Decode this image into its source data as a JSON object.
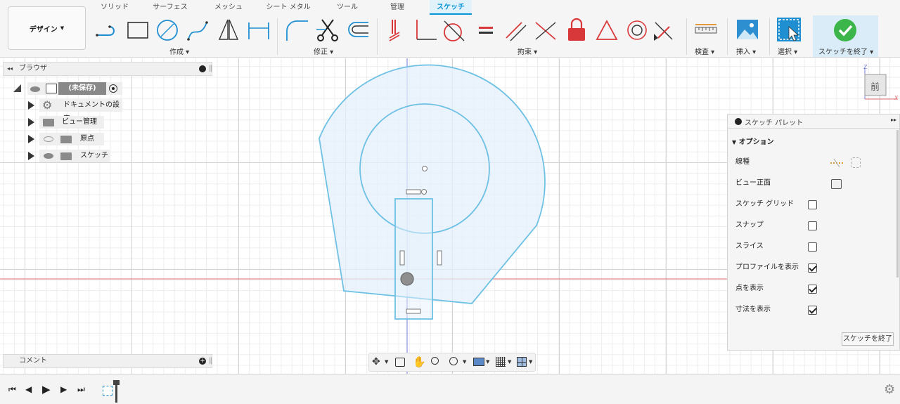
{
  "tabs": [
    "ソリッド",
    "サーフェス",
    "メッシュ",
    "シート メタル",
    "ツール",
    "管理",
    "スケッチ"
  ],
  "workspace_label": "デザイン",
  "groups": {
    "create": "作成",
    "modify": "修正",
    "constraints": "拘束",
    "inspect": "検査",
    "insert": "挿入",
    "select": "選択",
    "finish": "スケッチを終了"
  },
  "browser": {
    "title": "ブラウザ",
    "root": "(未保存)",
    "items": [
      "ドキュメントの設定",
      "ビュー管理",
      "原点",
      "スケッチ"
    ]
  },
  "comments": {
    "title": "コメント"
  },
  "viewcube": {
    "face": "前",
    "axis_z": "Z",
    "axis_x": "X"
  },
  "palette": {
    "title": "スケッチ パレット",
    "section": "オプション",
    "rows": {
      "linetype": "線種",
      "look_at": "ビュー正面",
      "grid": "スケッチ グリッド",
      "snap": "スナップ",
      "slice": "スライス",
      "profile": "プロファイルを表示",
      "points": "点を表示",
      "dims": "寸法を表示"
    },
    "checks": {
      "grid": false,
      "snap": false,
      "slice": false,
      "profile": true,
      "points": true,
      "dims": true
    },
    "finish_button": "スケッチを終了"
  },
  "colors": {
    "accent": "#0696d7",
    "sketch_line": "#6ec1e4",
    "profile_fill": "#e4f0fb",
    "finish_bg": "#d9ecf7",
    "constraint_red": "#d9383a"
  }
}
